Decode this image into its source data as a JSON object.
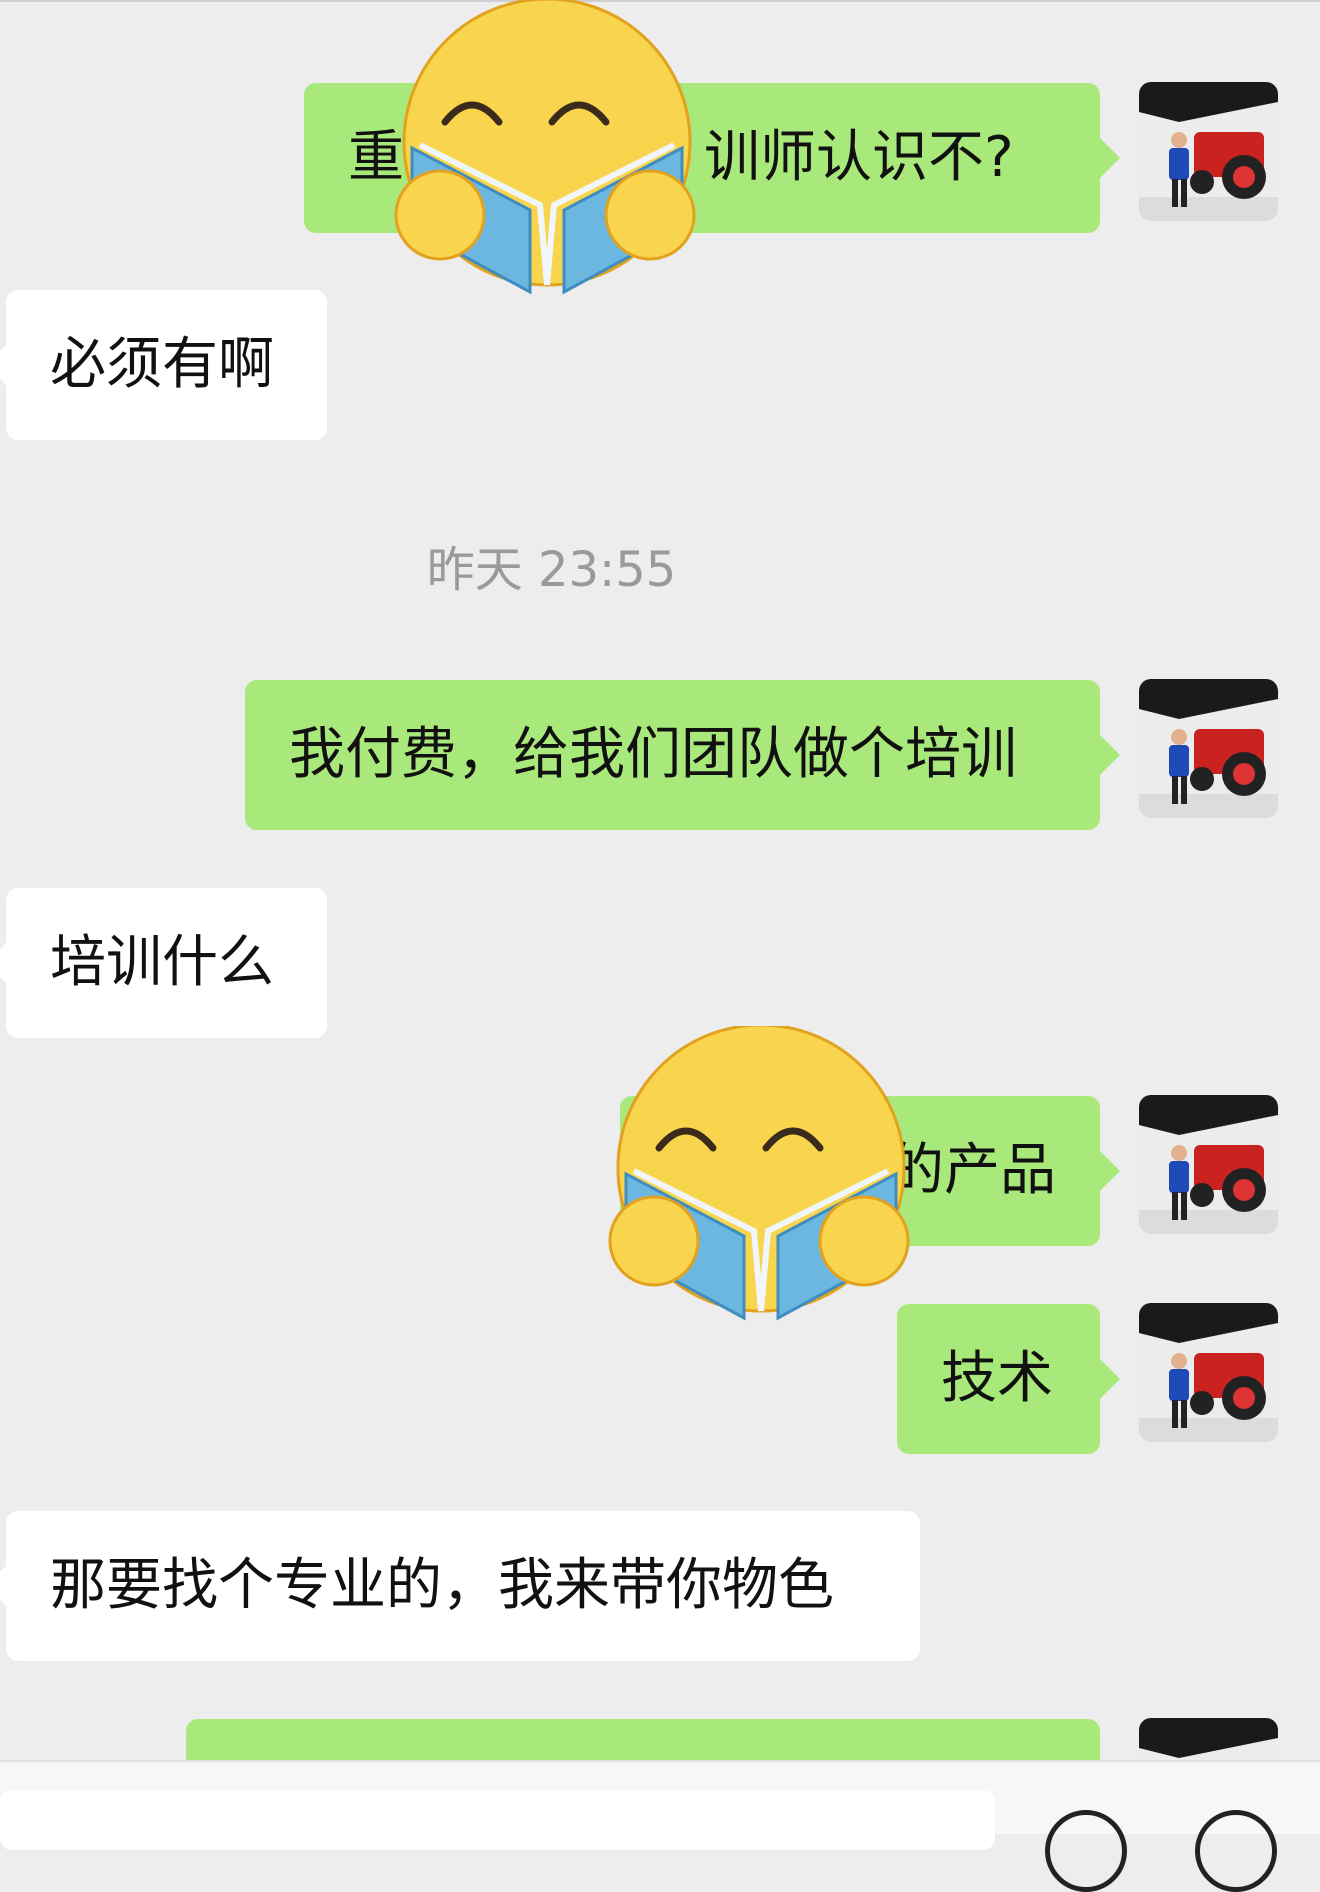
{
  "messages": [
    {
      "side": "out",
      "text": "重",
      "text_end": "训师认识不?",
      "obscured_by": "emoji-reading-book"
    },
    {
      "side": "in",
      "text": "必须有啊"
    },
    {
      "side": "out",
      "text": "我付费，给我们团队做个培训"
    },
    {
      "side": "in",
      "text": "培训什么"
    },
    {
      "side": "out",
      "text_end": "的产品",
      "obscured_by": "emoji-reading-book"
    },
    {
      "side": "out",
      "text": "技术"
    },
    {
      "side": "in",
      "text": "那要找个专业的，我来带你物色"
    },
    {
      "side": "out",
      "text": ""
    }
  ],
  "timestamp": "昨天 23:55",
  "colors": {
    "background": "#ededed",
    "outgoing_bubble": "#a9e87b",
    "incoming_bubble": "#ffffff",
    "emoji_face": "#f9d54e",
    "emoji_book": "#6bb7e0"
  },
  "icons": {
    "sticker": "emoji-reading-book",
    "avatar": "user-avatar-photo"
  }
}
